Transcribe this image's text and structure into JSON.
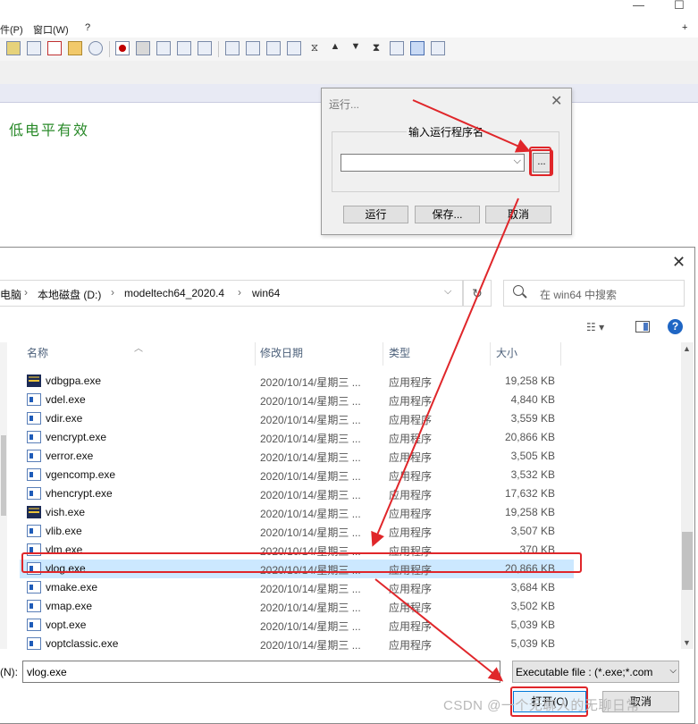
{
  "app": {
    "menu": [
      "件(P)",
      "窗口(W)",
      "?"
    ],
    "window_buttons": [
      "—",
      "☐",
      "+"
    ],
    "green_text": "低电平有效"
  },
  "run_dialog": {
    "title": "运行...",
    "group_label": "输入运行程序名",
    "browse_label": "...",
    "buttons": {
      "run": "运行",
      "save": "保存...",
      "cancel": "取消"
    }
  },
  "file_dialog": {
    "breadcrumb": [
      "电脑",
      "本地磁盘 (D:)",
      "modeltech64_2020.4",
      "win64"
    ],
    "search_placeholder": "在 win64 中搜索",
    "columns": {
      "name": "名称",
      "date": "修改日期",
      "type": "类型",
      "size": "大小"
    },
    "files": [
      {
        "name": "vdbgpa.exe",
        "date": "2020/10/14/星期三 ...",
        "type": "应用程序",
        "size": "19,258 KB",
        "icon": "dark"
      },
      {
        "name": "vdel.exe",
        "date": "2020/10/14/星期三 ...",
        "type": "应用程序",
        "size": "4,840 KB",
        "icon": "app"
      },
      {
        "name": "vdir.exe",
        "date": "2020/10/14/星期三 ...",
        "type": "应用程序",
        "size": "3,559 KB",
        "icon": "app"
      },
      {
        "name": "vencrypt.exe",
        "date": "2020/10/14/星期三 ...",
        "type": "应用程序",
        "size": "20,866 KB",
        "icon": "app"
      },
      {
        "name": "verror.exe",
        "date": "2020/10/14/星期三 ...",
        "type": "应用程序",
        "size": "3,505 KB",
        "icon": "app"
      },
      {
        "name": "vgencomp.exe",
        "date": "2020/10/14/星期三 ...",
        "type": "应用程序",
        "size": "3,532 KB",
        "icon": "app"
      },
      {
        "name": "vhencrypt.exe",
        "date": "2020/10/14/星期三 ...",
        "type": "应用程序",
        "size": "17,632 KB",
        "icon": "app"
      },
      {
        "name": "vish.exe",
        "date": "2020/10/14/星期三 ...",
        "type": "应用程序",
        "size": "19,258 KB",
        "icon": "dark"
      },
      {
        "name": "vlib.exe",
        "date": "2020/10/14/星期三 ...",
        "type": "应用程序",
        "size": "3,507 KB",
        "icon": "app"
      },
      {
        "name": "vlm.exe",
        "date": "2020/10/14/星期三 ...",
        "type": "应用程序",
        "size": "370 KB",
        "icon": "app"
      },
      {
        "name": "vlog.exe",
        "date": "2020/10/14/星期三 ...",
        "type": "应用程序",
        "size": "20,866 KB",
        "icon": "app",
        "selected": true
      },
      {
        "name": "vmake.exe",
        "date": "2020/10/14/星期三 ...",
        "type": "应用程序",
        "size": "3,684 KB",
        "icon": "app"
      },
      {
        "name": "vmap.exe",
        "date": "2020/10/14/星期三 ...",
        "type": "应用程序",
        "size": "3,502 KB",
        "icon": "app"
      },
      {
        "name": "vopt.exe",
        "date": "2020/10/14/星期三 ...",
        "type": "应用程序",
        "size": "5,039 KB",
        "icon": "app"
      },
      {
        "name": "voptclassic.exe",
        "date": "2020/10/14/星期三 ...",
        "type": "应用程序",
        "size": "5,039 KB",
        "icon": "app"
      }
    ],
    "filename_label": "(N):",
    "filename_value": "vlog.exe",
    "filetype": "Executable file : (*.exe;*.com",
    "open_label": "打开(O)",
    "cancel_label": "取消"
  },
  "watermark": "CSDN @一个无聊人的无聊日常",
  "colors": {
    "highlight": "#e0262a",
    "selection": "#cce8ff",
    "accent": "#0078d7"
  }
}
